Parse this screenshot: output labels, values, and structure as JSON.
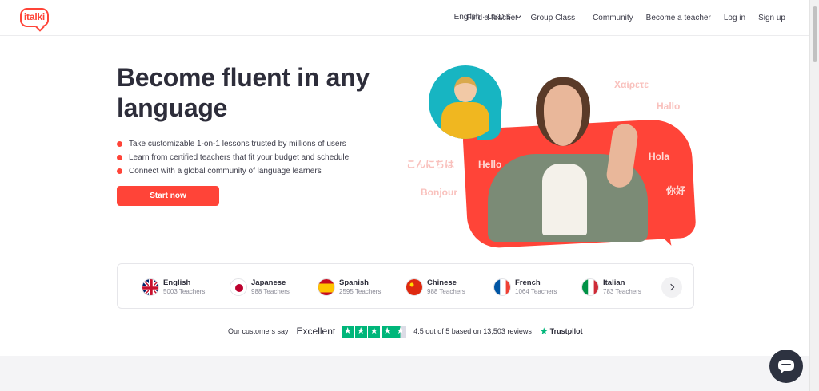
{
  "header": {
    "logo": "italki",
    "nav": [
      {
        "label": "English · USD $"
      },
      {
        "label": "Find a teacher"
      },
      {
        "label": "Group Class"
      },
      {
        "label": "Community"
      },
      {
        "label": "Become a teacher"
      },
      {
        "label": "Log in"
      },
      {
        "label": "Sign up"
      }
    ]
  },
  "hero": {
    "title": "Become fluent in any language",
    "bullets": [
      "Take customizable 1-on-1 lessons trusted by millions of users",
      "Learn from certified teachers that fit your budget and schedule",
      "Connect with a global community of language learners"
    ],
    "cta": "Start now",
    "greetings": [
      "Χαίρετε",
      "Hallo",
      "Hello",
      "Hola",
      "こんにちは",
      "Bonjour",
      "你好"
    ]
  },
  "languages": [
    {
      "name": "English",
      "count": "5003 Teachers"
    },
    {
      "name": "Japanese",
      "count": "988 Teachers"
    },
    {
      "name": "Spanish",
      "count": "2595 Teachers"
    },
    {
      "name": "Chinese",
      "count": "988 Teachers"
    },
    {
      "name": "French",
      "count": "1064 Teachers"
    },
    {
      "name": "Italian",
      "count": "783 Teachers"
    }
  ],
  "trust": {
    "prefix": "Our customers say",
    "rating_word": "Excellent",
    "stars": 4.5,
    "summary": "4.5 out of 5 based on 13,503 reviews",
    "brand": "Trustpilot"
  },
  "colors": {
    "brand": "#ff4438",
    "trust_green": "#00b67a",
    "text": "#2d2d3a"
  }
}
